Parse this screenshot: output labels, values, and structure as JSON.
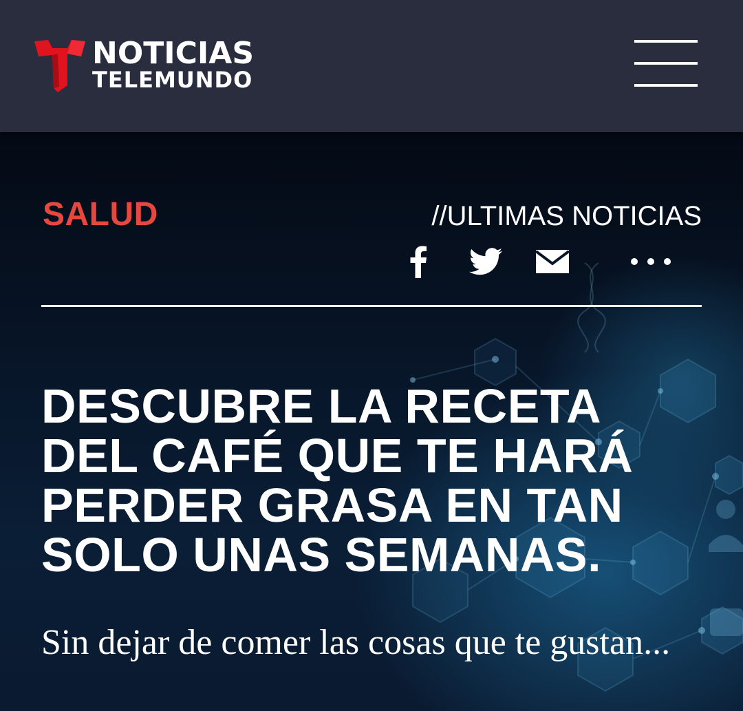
{
  "header": {
    "logo_line1": "NOTICIAS",
    "logo_line2": "TELEMUNDO",
    "menu_icon": "hamburger-menu-icon"
  },
  "article": {
    "category": "SALUD",
    "section": "//ULTIMAS NOTICIAS",
    "headline": "DESCUBRE LA RECETA DEL CAFÉ QUE TE HARÁ PERDER GRASA EN TAN SOLO UNAS SEMANAS.",
    "subtitle": "Sin dejar de comer las cosas que te gustan..."
  },
  "share": {
    "icons": [
      "facebook-icon",
      "twitter-icon",
      "email-icon",
      "more-icon"
    ]
  },
  "colors": {
    "header_bg": "#2a2d3e",
    "category": "#e8473f",
    "logo_red": "#e0131f"
  }
}
